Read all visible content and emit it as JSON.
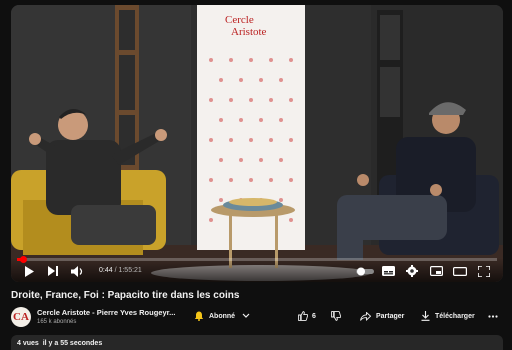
{
  "player": {
    "banner_text_line1": "Cercle",
    "banner_text_line2": "Aristote",
    "time_current": "0:44",
    "time_separator": " / ",
    "time_total": "1:55:21",
    "progress_fraction": 0.012,
    "accent_color": "#ff0000",
    "control_icons": [
      "play-icon",
      "next-icon",
      "volume-icon",
      "autoplay-toggle-icon",
      "subtitles-icon",
      "settings-icon",
      "miniplayer-icon",
      "theater-icon",
      "fullscreen-icon"
    ]
  },
  "video": {
    "title": "Droite, France, Foi : Papacito tire dans les coins"
  },
  "channel": {
    "avatar_letter": "CA",
    "name": "Cercle Aristote - Pierre Yves Rougeyr...",
    "subscribers": "165 k abonnés",
    "subscribed_label": "Abonné"
  },
  "actions": {
    "like_count": "6",
    "share_label": "Partager",
    "download_label": "Télécharger"
  },
  "meta": {
    "views": "4 vues",
    "age": "il y a 55 secondes"
  }
}
